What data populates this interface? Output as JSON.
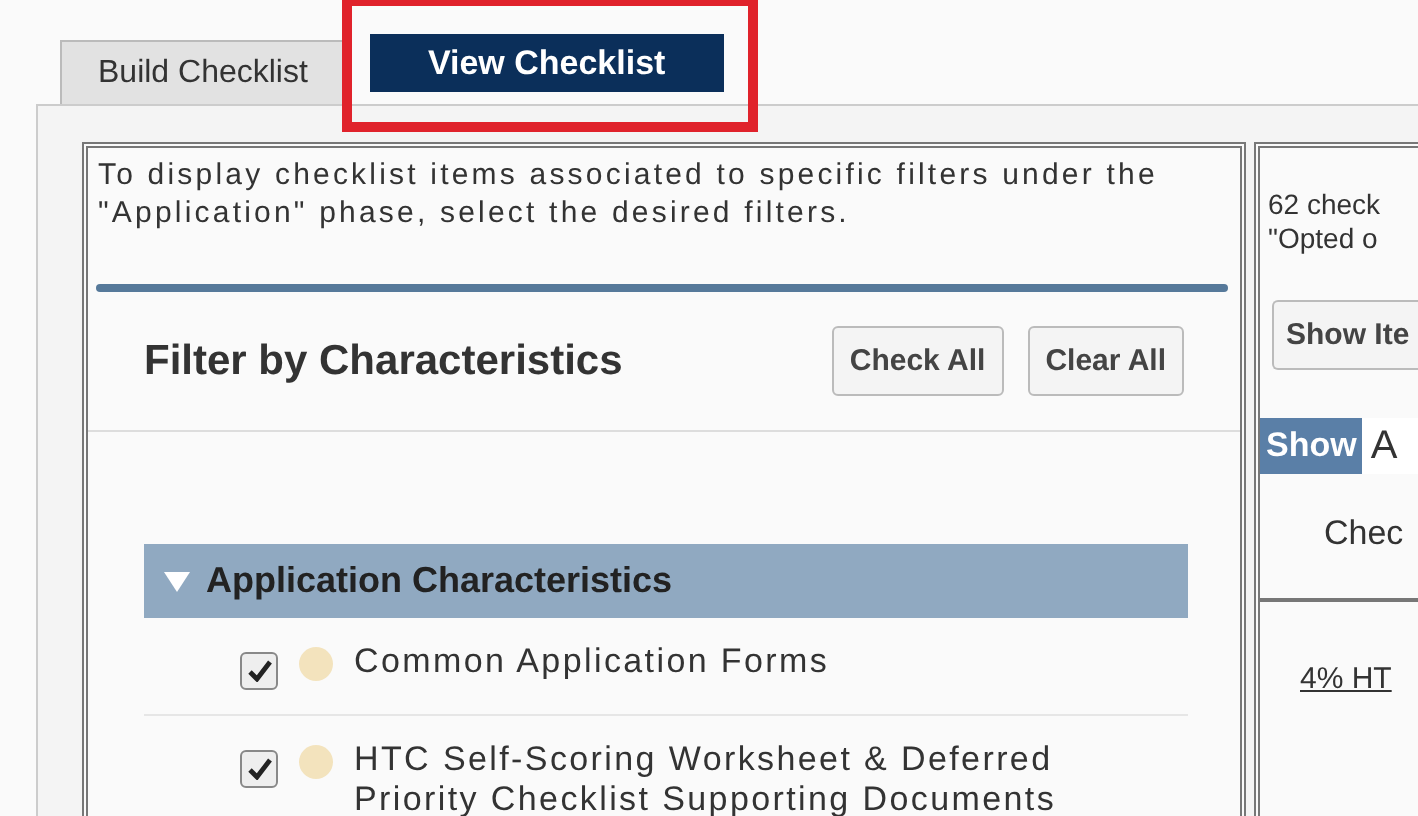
{
  "tabs": [
    {
      "label": "Build Checklist",
      "selected": false,
      "highlighted": false
    },
    {
      "label": "View Checklist",
      "selected": true,
      "highlighted": true
    }
  ],
  "filter_panel": {
    "instructions": "To display checklist items associated to specific filters under the \"Application\" phase, select the desired filters.",
    "title": "Filter by Characteristics",
    "buttons": [
      "Check All",
      "Clear All"
    ],
    "section": {
      "label": "Application Characteristics",
      "expanded": true,
      "items": [
        {
          "label": "Common Application Forms",
          "checked": true
        },
        {
          "label": "HTC Self-Scoring Worksheet & Deferred Priority Checklist Supporting Documents",
          "checked": true
        }
      ]
    }
  },
  "results_panel": {
    "summary_lines": [
      "62 check",
      "\"Opted o"
    ],
    "show_button": "Show Ite",
    "show_label": "Show",
    "show_field": {
      "value": "A"
    },
    "column_header": "Chec",
    "link": "4% HT"
  }
}
